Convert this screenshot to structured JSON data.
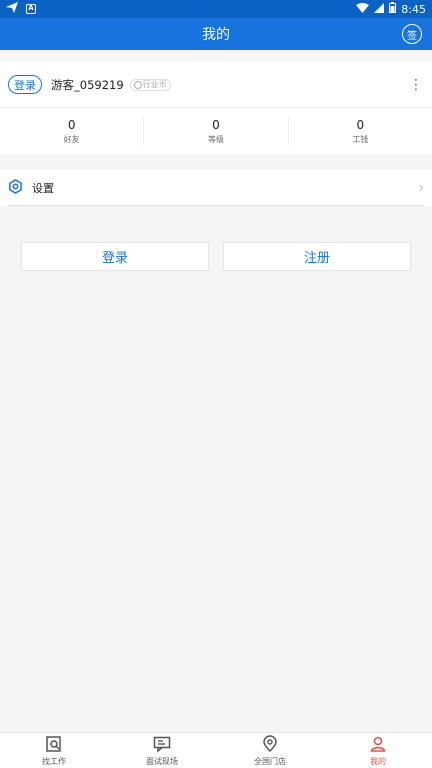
{
  "statusbar": {
    "time": "8:45"
  },
  "appbar": {
    "title": "我的",
    "sign_label": "签"
  },
  "profile": {
    "login_label": "登录",
    "username": "游客_059219",
    "tag": "行业币",
    "stats": [
      {
        "value": "0",
        "label": "好友"
      },
      {
        "value": "0",
        "label": "等级"
      },
      {
        "value": "0",
        "label": "工钱"
      }
    ]
  },
  "settings": {
    "label": "设置"
  },
  "buttons": {
    "login": "登录",
    "register": "注册"
  },
  "tabs": [
    {
      "label": "找工作",
      "icon": "job-search-icon",
      "active": false
    },
    {
      "label": "面试现场",
      "icon": "interview-chat-icon",
      "active": false
    },
    {
      "label": "全国门店",
      "icon": "store-location-icon",
      "active": false
    },
    {
      "label": "我的",
      "icon": "profile-icon",
      "active": true
    }
  ],
  "colors": {
    "primary": "#1774df",
    "statusbar": "#0a62c4",
    "active_tab": "#e05547"
  }
}
